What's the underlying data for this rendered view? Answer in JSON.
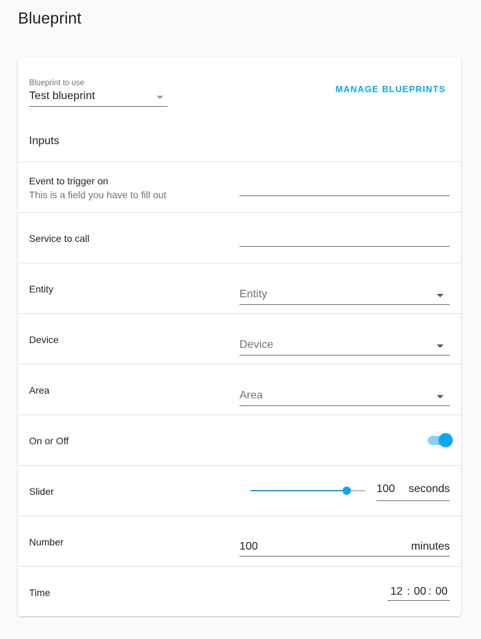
{
  "page": {
    "title": "Blueprint"
  },
  "blueprint": {
    "label": "Blueprint to use",
    "selected": "Test blueprint",
    "manage_label": "MANAGE BLUEPRINTS"
  },
  "inputs_heading": "Inputs",
  "fields": {
    "event": {
      "name": "Event to trigger on",
      "description": "This is a field you have to fill out",
      "value": ""
    },
    "service": {
      "name": "Service to call",
      "value": ""
    },
    "entity": {
      "name": "Entity",
      "placeholder": "Entity"
    },
    "device": {
      "name": "Device",
      "placeholder": "Device"
    },
    "area": {
      "name": "Area",
      "placeholder": "Area"
    },
    "on_off": {
      "name": "On or Off",
      "checked": true
    },
    "slider": {
      "name": "Slider",
      "value": "100",
      "unit": "seconds",
      "fraction": 0.84
    },
    "number": {
      "name": "Number",
      "value": "100",
      "unit": "minutes"
    },
    "time": {
      "name": "Time",
      "hours": "12",
      "minutes": "00",
      "seconds": "00",
      "separator": ":"
    }
  },
  "colors": {
    "accent": "#03a9f4",
    "accent_light": "#81d4fa",
    "divider": "#e3e3e3",
    "background": "#fafafa"
  }
}
